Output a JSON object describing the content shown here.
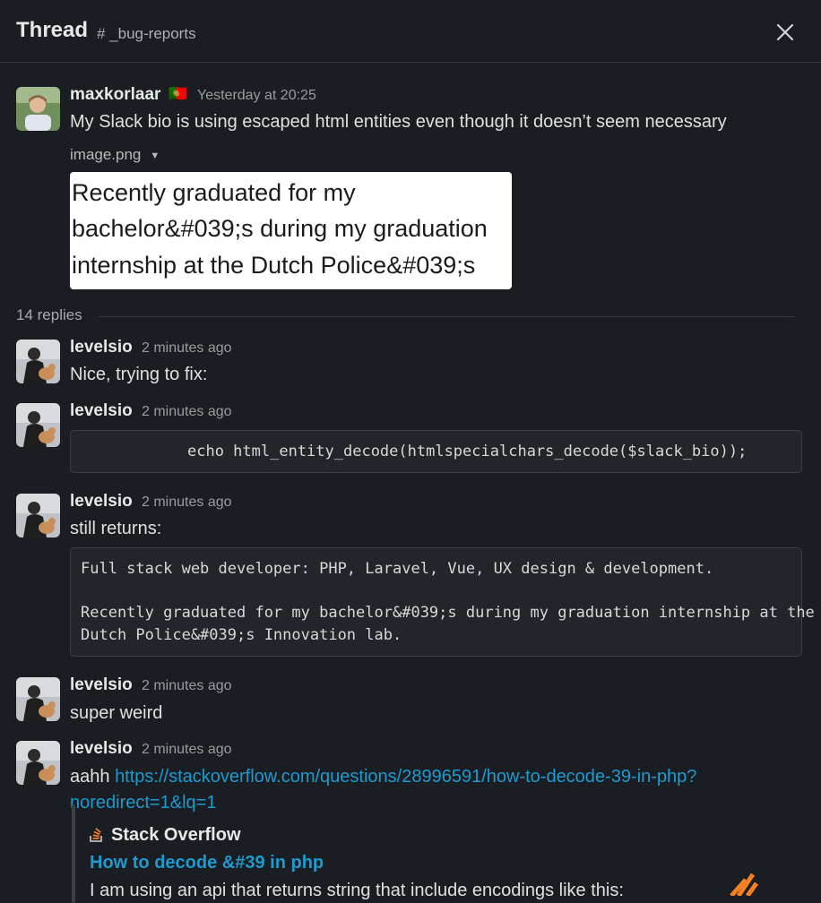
{
  "header": {
    "title": "Thread",
    "channel": "# _bug-reports"
  },
  "parent": {
    "author": "maxkorlaar",
    "flag": "🇵🇹",
    "time": "Yesterday at 20:25",
    "text": "My Slack bio is using escaped html entities even though it doesn’t seem necessary",
    "file": {
      "name": "image.png",
      "preview_lines": [
        "Recently graduated for my",
        "bachelor&#039;s during my graduation",
        "internship at the Dutch Police&#039;s"
      ]
    }
  },
  "replies_count": "14 replies",
  "replies": [
    {
      "author": "levelsio",
      "time": "2 minutes ago",
      "text": "Nice, trying to fix:"
    },
    {
      "author": "levelsio",
      "time": "2 minutes ago",
      "code": "echo html_entity_decode(htmlspecialchars_decode($slack_bio));"
    },
    {
      "author": "levelsio",
      "time": "2 minutes ago",
      "text": "still returns:",
      "code_lines": [
        "Full stack web developer: PHP, Laravel, Vue, UX design & development.",
        "Recently graduated for my bachelor&#039;s during my graduation internship at the",
        "Dutch Police&#039;s Innovation lab."
      ]
    },
    {
      "author": "levelsio",
      "time": "2 minutes ago",
      "text": "super weird"
    },
    {
      "author": "levelsio",
      "time": "2 minutes ago",
      "text_prefix": "aahh",
      "link_line1": "https://stackoverflow.com/questions/28996591/how-to-decode-39-in-php?",
      "link_line2": "noredirect=1&lq=1",
      "unfurl": {
        "source": "Stack Overflow",
        "title": "How to decode &#39 in php",
        "description": "I am using an api that returns string that include encodings like this:"
      }
    }
  ]
}
